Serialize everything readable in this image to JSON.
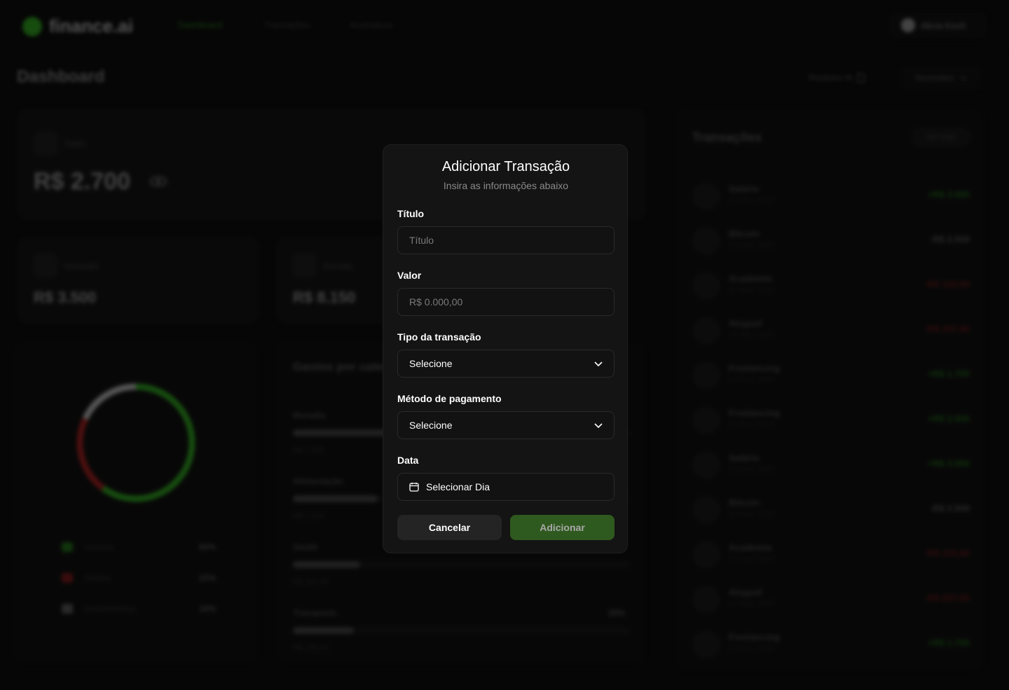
{
  "nav": {
    "brand": "finance.ai",
    "links": [
      "Dashboard",
      "Transações",
      "Assinatura"
    ],
    "user": "Alicia Koch"
  },
  "header": {
    "title": "Dashboard",
    "report_label": "Relatório IA",
    "month": "Novembro"
  },
  "summary": {
    "balance_label": "Saldo",
    "balance_value": "R$ 2.700",
    "invested_label": "Investido",
    "invested_value": "R$ 3.500",
    "income_label": "Receita",
    "income_value": "R$ 8.150"
  },
  "donut": {
    "segments": [
      {
        "name": "Ganhos",
        "pct": "60%",
        "fraction": 0.6,
        "color": "#2a8a1c"
      },
      {
        "name": "Gastos",
        "pct": "22%",
        "fraction": 0.22,
        "color": "#8a1c1c"
      },
      {
        "name": "Investimentos",
        "pct": "18%",
        "fraction": 0.18,
        "color": "#9a9a9a"
      }
    ]
  },
  "spending": {
    "title": "Gastos por categoria",
    "items": [
      {
        "name": "Moradia",
        "amount": "R$ 2.500",
        "fraction": 0.4
      },
      {
        "name": "Alimentação",
        "amount": "R$ 1.200",
        "fraction": 0.25
      },
      {
        "name": "Saúde",
        "amount": "R$ 320,00",
        "fraction": 0.2
      },
      {
        "name": "Transporte",
        "amount": "R$ 150,00",
        "pct": "20%",
        "fraction": 0.18
      }
    ]
  },
  "transactions": {
    "title": "Transações",
    "more_label": "Ver mais",
    "rows": [
      {
        "name": "Salário",
        "date": "15 Nov, 2024",
        "amount": "+R$ 3.900",
        "kind": "pos"
      },
      {
        "name": "Bitcoin",
        "date": "15 Nov, 2024",
        "amount": "-R$ 2.500",
        "kind": "neu"
      },
      {
        "name": "Academia",
        "date": "15 Nov, 2024",
        "amount": "-R$ 120,90",
        "kind": "neg"
      },
      {
        "name": "Aluguel",
        "date": "15 Nov, 2024",
        "amount": "-R$ 297,90",
        "kind": "neg"
      },
      {
        "name": "Freelancing",
        "date": "15 Nov, 2024",
        "amount": "+R$ 1.750",
        "kind": "pos"
      },
      {
        "name": "Freelancing",
        "date": "15 Nov, 2023",
        "amount": "+R$ 2.500",
        "kind": "pos"
      },
      {
        "name": "Salário",
        "date": "15 Nov, 2024",
        "amount": "+R$ 3.900",
        "kind": "pos"
      },
      {
        "name": "Bitcoin",
        "date": "15 Nov, 2024",
        "amount": "-R$ 2.500",
        "kind": "neu"
      },
      {
        "name": "Academia",
        "date": "15 Nov, 2024",
        "amount": "-R$ 120,90",
        "kind": "neg"
      },
      {
        "name": "Aluguel",
        "date": "15 Nov, 2024",
        "amount": "-R$ 297,90",
        "kind": "neg"
      },
      {
        "name": "Freelancing",
        "date": "15 Nov, 2024",
        "amount": "+R$ 1.750",
        "kind": "pos"
      }
    ]
  },
  "modal": {
    "title": "Adicionar Transação",
    "subtitle": "Insira as informações abaixo",
    "fields": {
      "title_label": "Título",
      "title_placeholder": "Título",
      "value_label": "Valor",
      "value_placeholder": "R$ 0.000,00",
      "type_label": "Tipo da transação",
      "type_value": "Selecione",
      "method_label": "Método de pagamento",
      "method_value": "Selecione",
      "date_label": "Data",
      "date_value": "Selecionar Dia"
    },
    "cancel_label": "Cancelar",
    "add_label": "Adicionar"
  },
  "colors": {
    "accent": "#2a8a1c",
    "negative": "#8a1c1c",
    "background": "#0b0b0b"
  }
}
